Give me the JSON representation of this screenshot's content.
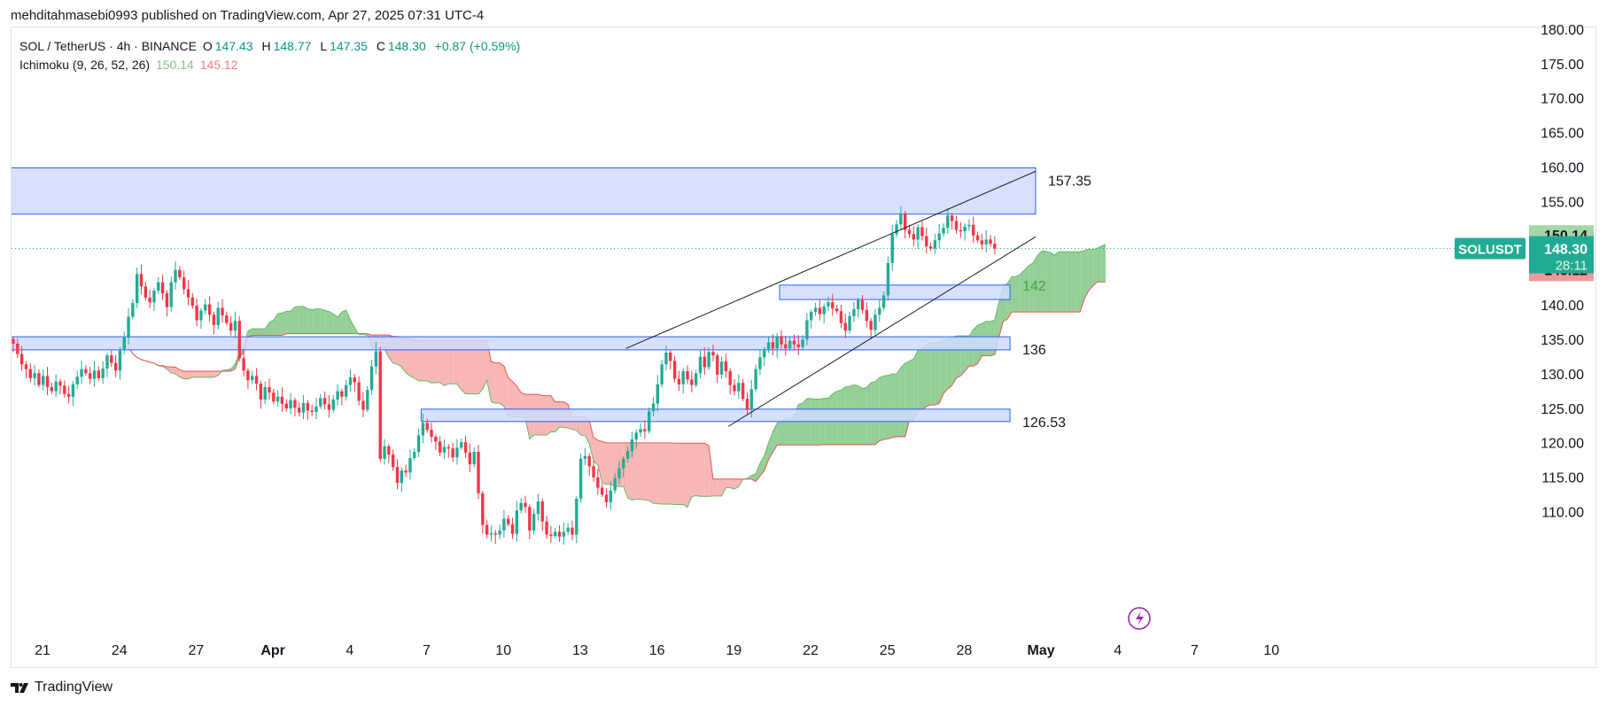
{
  "header": {
    "published": "mehditahmasebi0993 published on TradingView.com, Apr 27, 2025 07:31 UTC-4"
  },
  "legend": {
    "symbol": "SOL / TetherUS · 4h · BINANCE",
    "open_label": "O",
    "open": "147.43",
    "high_label": "H",
    "high": "148.77",
    "low_label": "L",
    "low": "147.35",
    "close_label": "C",
    "close": "148.30",
    "change": "+0.87 (+0.59%)",
    "indicator": "Ichimoku (9, 26, 52, 26)",
    "indicator_value_1": "150.14",
    "indicator_value_2": "145.12"
  },
  "footer": {
    "brand": "TradingView"
  },
  "colors": {
    "up": "#22ab94",
    "down": "#f23645",
    "cloud_bull": "#81c784",
    "cloud_bear": "#f7a9a7",
    "zone_fill": "#d0dcff",
    "zone_border": "#2962ff",
    "last_price": "#22ab94",
    "label_green": "#a5d6a7",
    "label_red": "#ef9a9a"
  },
  "chart_data": {
    "type": "candlestick",
    "symbol": "SOLUSDT",
    "timeframe": "4h",
    "ylim": [
      105,
      180
    ],
    "y_ticks": [
      "110.00",
      "115.00",
      "120.00",
      "125.00",
      "130.00",
      "135.00",
      "140.00",
      "145.00",
      "150.00",
      "155.00",
      "160.00",
      "165.00",
      "170.00",
      "175.00",
      "180.00"
    ],
    "x_ticks": [
      "21",
      "24",
      "27",
      "Apr",
      "4",
      "7",
      "10",
      "13",
      "16",
      "19",
      "22",
      "25",
      "28",
      "May",
      "4",
      "7",
      "10"
    ],
    "price_labels": {
      "symbol_tag": "SOLUSDT",
      "last": "148.30",
      "countdown": "28:11",
      "ichimoku_a": "150.14",
      "ichimoku_b": "145.12"
    },
    "zones": [
      {
        "label": "157.35",
        "top": 160.0,
        "bottom": 153.3,
        "from": "Mar 18",
        "to": "Apr 28"
      },
      {
        "label": "142",
        "top": 143.0,
        "bottom": 140.9,
        "from": "Apr 18",
        "to": "Apr 27"
      },
      {
        "label": "136",
        "top": 135.5,
        "bottom": 133.6,
        "from": "Mar 18",
        "to": "Apr 27"
      },
      {
        "label": "126.53",
        "top": 125.0,
        "bottom": 123.2,
        "from": "Apr 4",
        "to": "Apr 27"
      }
    ],
    "channel_lines": [
      {
        "from": [
          "Apr 12",
          133.8
        ],
        "to": [
          "Apr 28",
          159.5
        ]
      },
      {
        "from": [
          "Apr 16",
          122.5
        ],
        "to": [
          "Apr 28",
          150.0
        ]
      }
    ],
    "closes": [
      134.5,
      133.0,
      131.5,
      130.8,
      129.5,
      130.2,
      128.5,
      129.8,
      128.2,
      127.6,
      129.0,
      128.4,
      127.2,
      126.8,
      128.6,
      129.7,
      130.8,
      130.2,
      129.4,
      130.6,
      129.5,
      130.9,
      132.8,
      131.7,
      130.6,
      133.6,
      135.4,
      138.4,
      140.4,
      144.6,
      142.8,
      141.2,
      140.5,
      142.2,
      143.4,
      141.8,
      139.8,
      143.4,
      145.2,
      144.1,
      142.4,
      141.2,
      140.0,
      137.9,
      139.3,
      140.2,
      138.7,
      137.2,
      139.7,
      138.6,
      137.5,
      136.4,
      137.8,
      132.4,
      130.6,
      129.2,
      129.8,
      128.7,
      126.4,
      128.2,
      127.4,
      126.1,
      126.8,
      125.8,
      125.1,
      126.3,
      125.2,
      124.5,
      125.9,
      124.8,
      124.6,
      125.4,
      126.6,
      125.7,
      124.9,
      126.4,
      127.6,
      126.8,
      128.5,
      129.6,
      128.9,
      126.2,
      124.9,
      127.8,
      131.2,
      133.4,
      117.8,
      119.6,
      118.4,
      116.6,
      114.3,
      116.1,
      115.8,
      117.9,
      118.8,
      121.2,
      123.0,
      122.0,
      121.0,
      120.3,
      118.7,
      119.5,
      119.3,
      118.0,
      119.4,
      120.2,
      118.7,
      117.0,
      118.8,
      112.8,
      108.2,
      106.8,
      107.0,
      106.8,
      107.4,
      109.1,
      108.3,
      106.9,
      110.3,
      111.4,
      110.8,
      107.4,
      109.8,
      111.6,
      108.7,
      106.8,
      106.6,
      107.2,
      106.5,
      107.2,
      107.8,
      106.8,
      112.0,
      117.8,
      118.2,
      116.7,
      115.1,
      113.6,
      112.6,
      111.5,
      113.2,
      115.0,
      116.4,
      117.8,
      118.9,
      120.6,
      121.6,
      122.1,
      121.8,
      124.7,
      125.8,
      128.6,
      131.5,
      133.2,
      132.0,
      129.4,
      128.6,
      130.5,
      129.3,
      128.5,
      130.2,
      132.6,
      131.1,
      133.3,
      132.8,
      130.0,
      131.9,
      130.5,
      128.5,
      127.6,
      128.8,
      126.5,
      124.9,
      127.9,
      130.8,
      132.5,
      133.7,
      134.7,
      133.8,
      135.6,
      134.4,
      133.8,
      134.9,
      134.4,
      134.0,
      135.1,
      137.9,
      139.1,
      139.7,
      138.8,
      139.9,
      140.5,
      139.6,
      139.2,
      137.5,
      136.4,
      138.5,
      139.5,
      140.8,
      139.4,
      137.8,
      136.5,
      138.7,
      139.7,
      141.5,
      146.2,
      150.4,
      151.8,
      153.4,
      151.0,
      150.4,
      149.6,
      151.4,
      150.1,
      148.6,
      148.3,
      149.5,
      150.5,
      151.3,
      153.1,
      152.3,
      151.0,
      150.8,
      151.5,
      151.7,
      150.2,
      149.5,
      148.9,
      149.6,
      149.0,
      148.3
    ]
  }
}
